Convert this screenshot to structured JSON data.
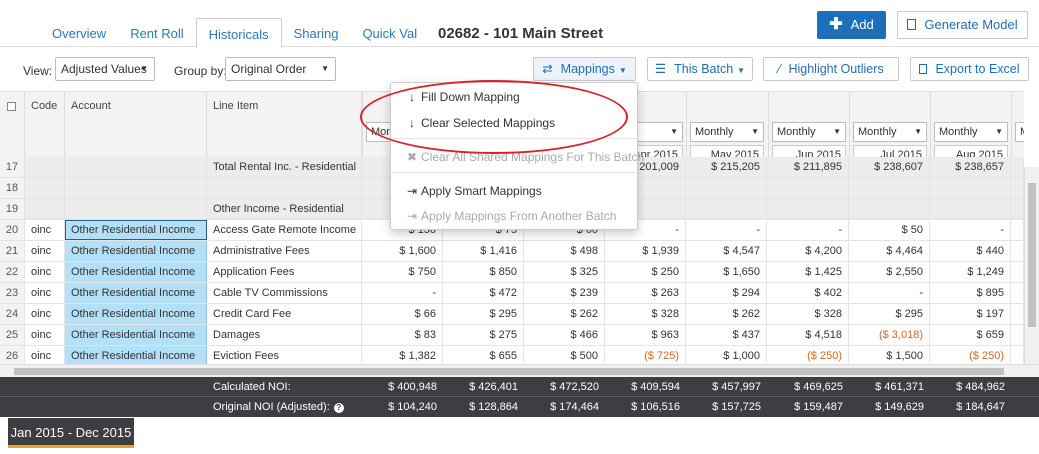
{
  "header": {
    "tabs": [
      {
        "label": "Overview",
        "active": false
      },
      {
        "label": "Rent Roll",
        "active": false
      },
      {
        "label": "Historicals",
        "active": true
      },
      {
        "label": "Sharing",
        "active": false
      },
      {
        "label": "Quick Val",
        "active": false
      }
    ],
    "property_title": "02682 - 101 Main Street",
    "add_label": "Add",
    "generate_label": "Generate Model"
  },
  "toolbar": {
    "view_label": "View:",
    "view_value": "Adjusted Values",
    "groupby_label": "Group by:",
    "groupby_value": "Original Order",
    "mappings_label": "Mappings",
    "batch_label": "This Batch",
    "outliers_label": "Highlight Outliers",
    "export_label": "Export to Excel"
  },
  "menu": {
    "items": [
      {
        "label": "Fill Down Mapping",
        "icon": "arrow-down-icon",
        "disabled": false
      },
      {
        "label": "Clear Selected Mappings",
        "icon": "arrow-down-icon",
        "disabled": false
      },
      {
        "label": "Clear All Shared Mappings For This Batch",
        "icon": "x-icon",
        "disabled": true
      },
      {
        "label": "Apply Smart Mappings",
        "icon": "sign-in-icon",
        "disabled": false
      },
      {
        "label": "Apply Mappings From Another Batch",
        "icon": "sign-in-icon",
        "disabled": true
      }
    ]
  },
  "grid": {
    "headers": {
      "code": "Code",
      "account": "Account",
      "line_item": "Line Item"
    },
    "month_columns": [
      {
        "freq": "Mont",
        "date": ""
      },
      {
        "freq": "",
        "date": ""
      },
      {
        "freq": "",
        "date": ""
      },
      {
        "freq": "hly",
        "date": "Apr 2015"
      },
      {
        "freq": "Monthly",
        "date": "May 2015"
      },
      {
        "freq": "Monthly",
        "date": "Jun 2015"
      },
      {
        "freq": "Monthly",
        "date": "Jul 2015"
      },
      {
        "freq": "Monthly",
        "date": "Aug 2015"
      },
      {
        "freq": "Mon",
        "date": ""
      }
    ],
    "rows": [
      {
        "n": "17",
        "code": "",
        "account": "",
        "line": "Total Rental Inc. - Residential",
        "vals": [
          "",
          "",
          "",
          "$ 201,009",
          "$ 215,205",
          "$ 211,895",
          "$ 238,607",
          "$ 238,657"
        ],
        "gray": true,
        "partial": true
      },
      {
        "n": "18",
        "code": "",
        "account": "",
        "line": "",
        "vals": [
          "",
          "",
          "",
          "",
          "",
          "",
          "",
          ""
        ],
        "gray": true
      },
      {
        "n": "19",
        "code": "",
        "account": "",
        "line": "Other Income - Residential",
        "vals": [
          "",
          "",
          "",
          "",
          "",
          "",
          "",
          ""
        ],
        "gray": true
      },
      {
        "n": "20",
        "code": "oinc",
        "account": "Other Residential Income",
        "line": "Access Gate Remote Income",
        "vals": [
          "$ 150",
          "$ 75",
          "$ 60",
          "-",
          "-",
          "-",
          "$ 50",
          "-"
        ],
        "selected": true
      },
      {
        "n": "21",
        "code": "oinc",
        "account": "Other Residential Income",
        "line": "Administrative Fees",
        "vals": [
          "$ 1,600",
          "$ 1,416",
          "$ 498",
          "$ 1,939",
          "$ 4,547",
          "$ 4,200",
          "$ 4,464",
          "$ 440"
        ]
      },
      {
        "n": "22",
        "code": "oinc",
        "account": "Other Residential Income",
        "line": "Application Fees",
        "vals": [
          "$ 750",
          "$ 850",
          "$ 325",
          "$ 250",
          "$ 1,650",
          "$ 1,425",
          "$ 2,550",
          "$ 1,249"
        ]
      },
      {
        "n": "23",
        "code": "oinc",
        "account": "Other Residential Income",
        "line": "Cable TV Commissions",
        "vals": [
          "-",
          "$ 472",
          "$ 239",
          "$ 263",
          "$ 294",
          "$ 402",
          "-",
          "$ 895"
        ]
      },
      {
        "n": "24",
        "code": "oinc",
        "account": "Other Residential Income",
        "line": "Credit Card Fee",
        "vals": [
          "$ 66",
          "$ 295",
          "$ 262",
          "$ 328",
          "$ 262",
          "$ 328",
          "$ 295",
          "$ 197"
        ]
      },
      {
        "n": "25",
        "code": "oinc",
        "account": "Other Residential Income",
        "line": "Damages",
        "vals": [
          "$ 83",
          "$ 275",
          "$ 466",
          "$ 963",
          "$ 437",
          "$ 4,518",
          "($ 3,018)",
          "$ 659"
        ]
      },
      {
        "n": "26",
        "code": "oinc",
        "account": "Other Residential Income",
        "line": "Eviction Fees",
        "vals": [
          "$ 1,382",
          "$ 655",
          "$ 500",
          "($ 725)",
          "$ 1,000",
          "($ 250)",
          "$ 1,500",
          "($ 250)"
        ]
      }
    ]
  },
  "footer": {
    "calc_label": "Calculated NOI:",
    "calc_vals": [
      "$ 400,948",
      "$ 426,401",
      "$ 472,520",
      "$ 409,594",
      "$ 457,997",
      "$ 469,625",
      "$ 461,371",
      "$ 484,962"
    ],
    "orig_label": "Original NOI (Adjusted):",
    "orig_help": "?",
    "orig_vals": [
      "$ 104,240",
      "$ 128,864",
      "$ 174,464",
      "$ 106,516",
      "$ 157,725",
      "$ 159,487",
      "$ 149,629",
      "$ 184,647"
    ]
  },
  "period": "Jan 2015 - Dec 2015",
  "colors": {
    "primary": "#1c6fb8",
    "account_highlight": "#b3e0f7",
    "footer_bg": "#3d3d42",
    "negative": "#d26a1e",
    "annotation": "#d9222a"
  }
}
